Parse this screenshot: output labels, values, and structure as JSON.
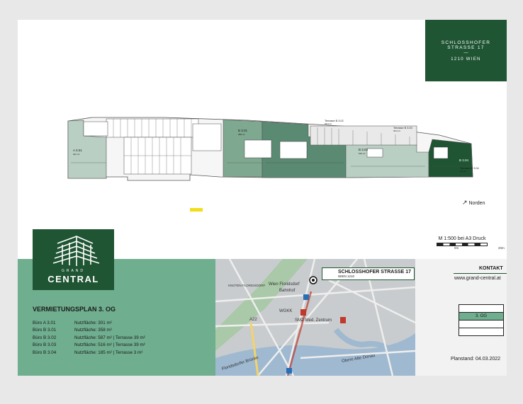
{
  "title_box": {
    "line1": "SCHLOSSHOFER",
    "line2": "STRASSE 17",
    "dash": "—",
    "line3": "1210 WIEN"
  },
  "plan": {
    "units": [
      {
        "label": "A 3.01",
        "area": "301 m²"
      },
      {
        "label": "B 3.01",
        "area": "358 m²"
      },
      {
        "label": "B 3.02",
        "area": "587 m²"
      },
      {
        "label": "B 3.03",
        "area": "516 m²"
      },
      {
        "label": "B 3.04",
        "area": "185 m²"
      }
    ],
    "terraces": [
      {
        "label": "Terrasse B 3.02",
        "area": "39 m²"
      },
      {
        "label": "Terrasse B 3.03",
        "area": "39 m²"
      },
      {
        "label": "Terrasse B 3.04",
        "area": "3 m²"
      }
    ]
  },
  "north_label": "Norden",
  "scale": {
    "text": "M 1:500 bei A3 Druck",
    "start": "0m",
    "end": "20m"
  },
  "logo": {
    "grand": "GRAND",
    "central": "CENTRAL"
  },
  "rental": {
    "title": "VERMIETUNGSPLAN 3. OG",
    "rows": [
      {
        "name": "Büro A 3.01",
        "detail": "Nutzfläche: 301 m²"
      },
      {
        "name": "Büro B 3.01",
        "detail": "Nutzfläche: 358 m²"
      },
      {
        "name": "Büro B 3.02",
        "detail": "Nutzfläche: 587 m² | Terrasse 39 m²"
      },
      {
        "name": "Büro B 3.03",
        "detail": "Nutzfläche: 516 m² | Terrasse 39 m²"
      },
      {
        "name": "Büro B 3.04",
        "detail": "Nutzfläche: 185 m² | Terrasse   3 m²"
      }
    ]
  },
  "map": {
    "label_title": "SCHLOSSHOFER STRASSE 17",
    "label_sub": "WIEN 1210",
    "places": [
      "Wien Floridsdorf",
      "Bahnhof",
      "WGKK",
      "SMZ-Med. Zentrum",
      "Floridsdorfer Brücke",
      "Obere Alte Donau",
      "A22",
      "KNOTEN FLORIDSDORF"
    ]
  },
  "contact": {
    "heading": "KONTAKT",
    "website": "www.grand-central.at"
  },
  "floors": [
    {
      "label": ""
    },
    {
      "label": "3. OG"
    },
    {
      "label": ""
    },
    {
      "label": ""
    }
  ],
  "planstand": "Planstand: 04.03.2022",
  "colors": {
    "brand": "#1f5533",
    "accent": "#6fae8e",
    "unit_dark": "#5a8a72",
    "unit_mid": "#7fa891",
    "unit_light": "#b9cfc3"
  }
}
